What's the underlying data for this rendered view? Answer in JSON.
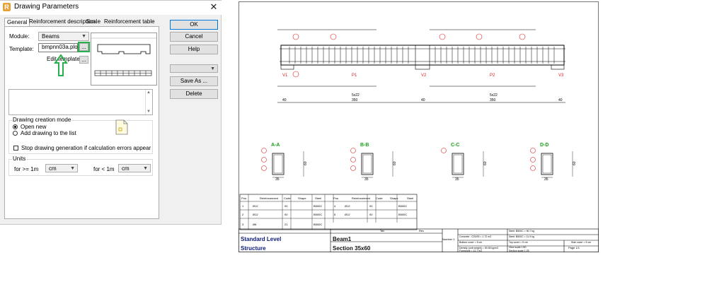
{
  "dialog": {
    "title": "Drawing Parameters",
    "app_icon": "R",
    "close_icon": "✕",
    "tabs": [
      "General",
      "Reinforcement description",
      "Scale",
      "Reinforcement table"
    ],
    "module_label": "Module:",
    "module_value": "Beams",
    "template_label": "Template:",
    "template_value": "bmpnn03a.plo",
    "template_browse": "...",
    "edit_template_label": "Edit template:",
    "edit_template_browse": "...",
    "drawing_mode_title": "Drawing creation mode",
    "radio_open_new": "Open new",
    "radio_add_drawing": "Add drawing to the list",
    "checkbox_stop": "Stop drawing generation if calculation errors appear",
    "units_title": "Units",
    "units_ge_label": "for >= 1m",
    "units_ge_value": "cm",
    "units_lt_label": "for < 1m",
    "units_lt_value": "cm",
    "buttons": {
      "ok": "OK",
      "cancel": "Cancel",
      "help": "Help",
      "save_as": "Save As ...",
      "delete": "Delete"
    },
    "accent_colors": {
      "highlight_box": "#27b04d",
      "arrow": "#27b04d",
      "ok_border": "#0078d7"
    }
  },
  "drawing": {
    "supports": [
      "V1",
      "P1",
      "V2",
      "P2",
      "V3"
    ],
    "dims_top": [
      "40",
      "350",
      "40",
      "350",
      "40"
    ],
    "dims_sub": [
      "5x22",
      "5x22"
    ],
    "sections": [
      "A-A",
      "B-B",
      "C-C",
      "D-D"
    ],
    "section_height": "60",
    "section_width": "35",
    "table_headers": [
      "Pos.",
      "Reinforcement",
      "Code",
      "Shape",
      "Steel"
    ],
    "table_rows": [
      {
        "pos": "1",
        "reinf": "Ø12",
        "code": "00",
        "steel": "B500C"
      },
      {
        "pos": "2",
        "reinf": "Ø12",
        "code": "00",
        "steel": "B500C"
      },
      {
        "pos": "3",
        "reinf": "Ø8",
        "code": "21",
        "steel": "B500C"
      }
    ],
    "table_rows_right": [
      {
        "pos": "4",
        "reinf": "Ø12",
        "code": "00",
        "steel": "B500C"
      },
      {
        "pos": "5",
        "reinf": "Ø12",
        "code": "00",
        "steel": "B500C"
      }
    ],
    "title_block": {
      "title1": "Standard Level",
      "title2": "Structure",
      "beam": "Beam1",
      "section": "Section 35x60",
      "col_tav": "Tav",
      "col_rev": "Rev",
      "number": "Number 1",
      "concrete": "Concrete : C20/25 = 1.72 m3",
      "bottom_cover": "Bottom cover = 5 cm",
      "density": "Density (unit weight) = 59.38 kg/m3",
      "formwork": "Formwork = 12.7 m2",
      "steel1": "Steel: B500C = 90.7 kg",
      "steel2": "Steel: B500C = 11.9 kg",
      "top_cover": "Top cover = 5 cm",
      "side_cover": "Side cover = 5 cm",
      "view_scale": "View scale 1:50",
      "section_scale": "Section scale 1:25",
      "page": "Page 1/1"
    }
  }
}
